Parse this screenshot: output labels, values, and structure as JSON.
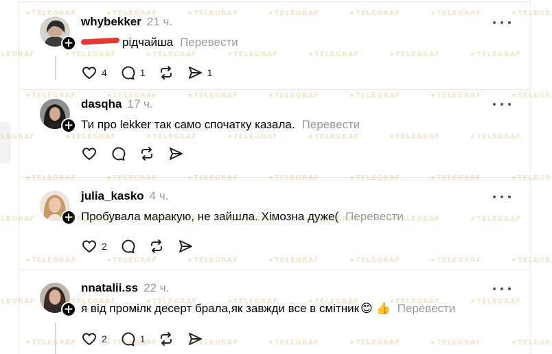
{
  "watermark": "TELEGRAF",
  "comments": [
    {
      "username": "whybekker",
      "time": "21 ч.",
      "text_after_redaction": "рідчайша",
      "translate": "Перевести",
      "likes": "4",
      "replies": "1",
      "shares": "1",
      "avatar": "avatar-photo"
    },
    {
      "username": "dasqha",
      "time": "17 ч.",
      "text": "Ти про lekker так само спочатку казала.",
      "translate": "Перевести",
      "avatar": "avatar-photo"
    },
    {
      "username": "julia_kasko",
      "time": "4 ч.",
      "text": "Пробувала маракую, не зайшла. Хімозна дуже(",
      "translate": "Перевести",
      "likes": "2",
      "avatar": "avatar-photo"
    },
    {
      "username": "nnatalii.ss",
      "time": "22 ч.",
      "text": "я від промілк десерт брала,як завжди все в смітник",
      "emoji": "😊 👍",
      "translate": "Перевести",
      "likes": "2",
      "replies": "1",
      "avatar": "avatar-photo"
    }
  ],
  "icons": {
    "like": "heart-icon",
    "reply": "comment-bubble-icon",
    "repost": "repost-icon",
    "share": "send-icon",
    "more": "more-dots-icon",
    "follow": "plus-icon"
  },
  "colors": {
    "username": "#000000",
    "muted": "#999999",
    "redaction": "#e53935",
    "divider": "#e8e8e8"
  }
}
